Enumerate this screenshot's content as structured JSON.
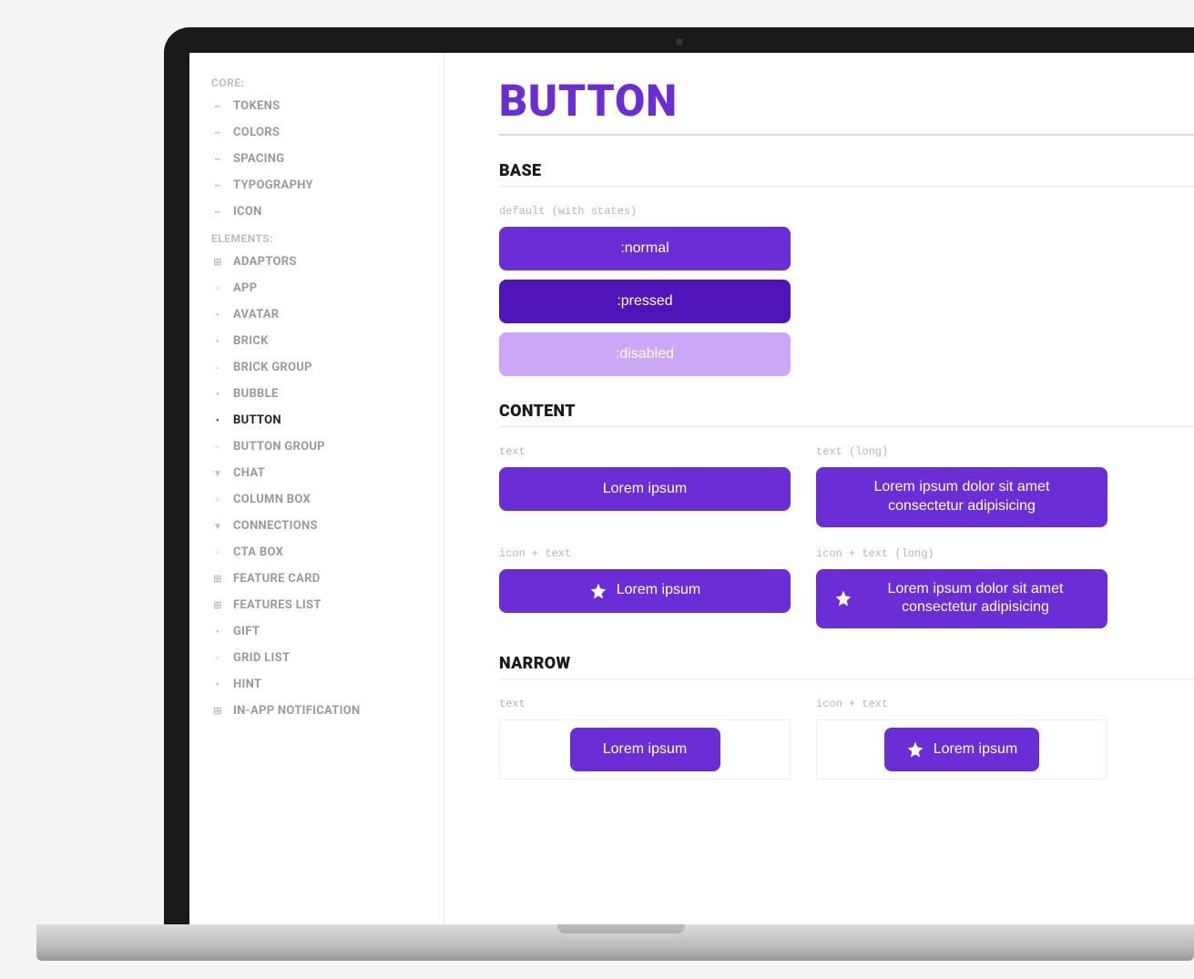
{
  "colors": {
    "accent": "#6b2ed6",
    "accent_pressed": "#4f15b8",
    "accent_disabled": "#cba8f7"
  },
  "sidebar": {
    "groups": [
      {
        "label": "CORE:",
        "items": [
          {
            "label": "TOKENS",
            "icon": "tilde"
          },
          {
            "label": "COLORS",
            "icon": "tilde"
          },
          {
            "label": "SPACING",
            "icon": "tilde"
          },
          {
            "label": "TYPOGRAPHY",
            "icon": "tilde"
          },
          {
            "label": "ICON",
            "icon": "tilde"
          }
        ]
      },
      {
        "label": "ELEMENTS:",
        "items": [
          {
            "label": "ADAPTORS",
            "icon": "tree"
          },
          {
            "label": "APP",
            "icon": "box"
          },
          {
            "label": "AVATAR",
            "icon": "dot"
          },
          {
            "label": "BRICK",
            "icon": "dot"
          },
          {
            "label": "BRICK GROUP",
            "icon": "box"
          },
          {
            "label": "BUBBLE",
            "icon": "dot"
          },
          {
            "label": "BUTTON",
            "icon": "dot",
            "active": true
          },
          {
            "label": "BUTTON GROUP",
            "icon": "box"
          },
          {
            "label": "CHAT",
            "icon": "caret"
          },
          {
            "label": "COLUMN BOX",
            "icon": "box"
          },
          {
            "label": "CONNECTIONS",
            "icon": "caret"
          },
          {
            "label": "CTA BOX",
            "icon": "box"
          },
          {
            "label": "FEATURE CARD",
            "icon": "tree"
          },
          {
            "label": "FEATURES LIST",
            "icon": "tree"
          },
          {
            "label": "GIFT",
            "icon": "dot"
          },
          {
            "label": "GRID LIST",
            "icon": "box"
          },
          {
            "label": "HINT",
            "icon": "dot"
          },
          {
            "label": "IN-APP NOTIFICATION",
            "icon": "tree"
          }
        ]
      }
    ]
  },
  "page": {
    "title": "BUTTON",
    "sections": {
      "base": {
        "title": "BASE",
        "variant_label": "default (with states)",
        "states": {
          "normal": ":normal",
          "pressed": ":pressed",
          "disabled": ":disabled"
        }
      },
      "content": {
        "title": "CONTENT",
        "variants": {
          "text": {
            "label": "text",
            "value": "Lorem ipsum"
          },
          "text_long": {
            "label": "text (long)",
            "value": "Lorem ipsum dolor sit amet consectetur adipisicing"
          },
          "icon_text": {
            "label": "icon + text",
            "value": "Lorem ipsum"
          },
          "icon_text_long": {
            "label": "icon + text (long)",
            "value": "Lorem ipsum dolor sit amet consectetur adipisicing"
          }
        }
      },
      "narrow": {
        "title": "NARROW",
        "variants": {
          "text": {
            "label": "text",
            "value": "Lorem ipsum"
          },
          "icon_text": {
            "label": "icon + text",
            "value": "Lorem ipsum"
          }
        }
      }
    }
  }
}
